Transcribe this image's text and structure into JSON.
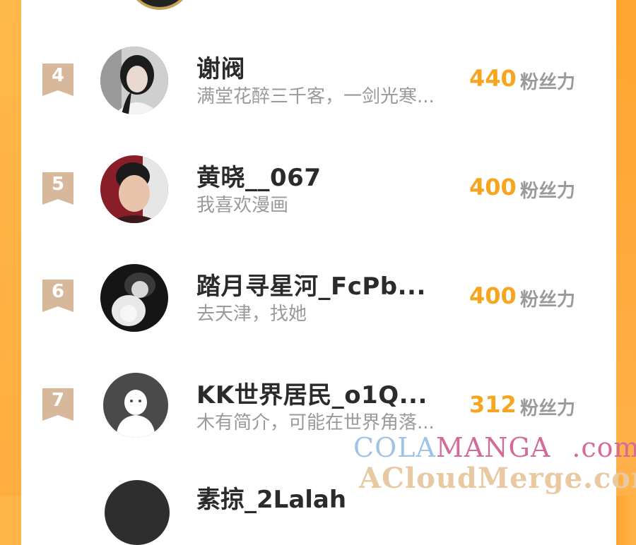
{
  "unit_label": "粉丝力",
  "rows": [
    {
      "rank": "4",
      "name": "谢阀",
      "desc": "满堂花醉三千客，一剑光寒...",
      "score": "440"
    },
    {
      "rank": "5",
      "name": "黄晓__067",
      "desc": "我喜欢漫画",
      "score": "400"
    },
    {
      "rank": "6",
      "name": "踏月寻星河_FcPb...",
      "desc": "去天津，找她",
      "score": "400"
    },
    {
      "rank": "7",
      "name": "KK世界居民_o1Q...",
      "desc": "木有简介，可能在世界角落...",
      "score": "312"
    }
  ],
  "next_row": {
    "name": "素掠_2Lalah"
  },
  "watermark": {
    "line1_part1": "COLA",
    "line1_part2": "MANGA",
    "line1_part3": ".com",
    "line2": "ACloudMerge.com"
  },
  "colors": {
    "accent": "#f7a51e",
    "rank_badge": "#d7b89a",
    "side_strip": "#ffad3e"
  },
  "icons": {
    "default_avatar": "person-silhouette-icon",
    "rank_badge": "ribbon-badge-icon"
  }
}
